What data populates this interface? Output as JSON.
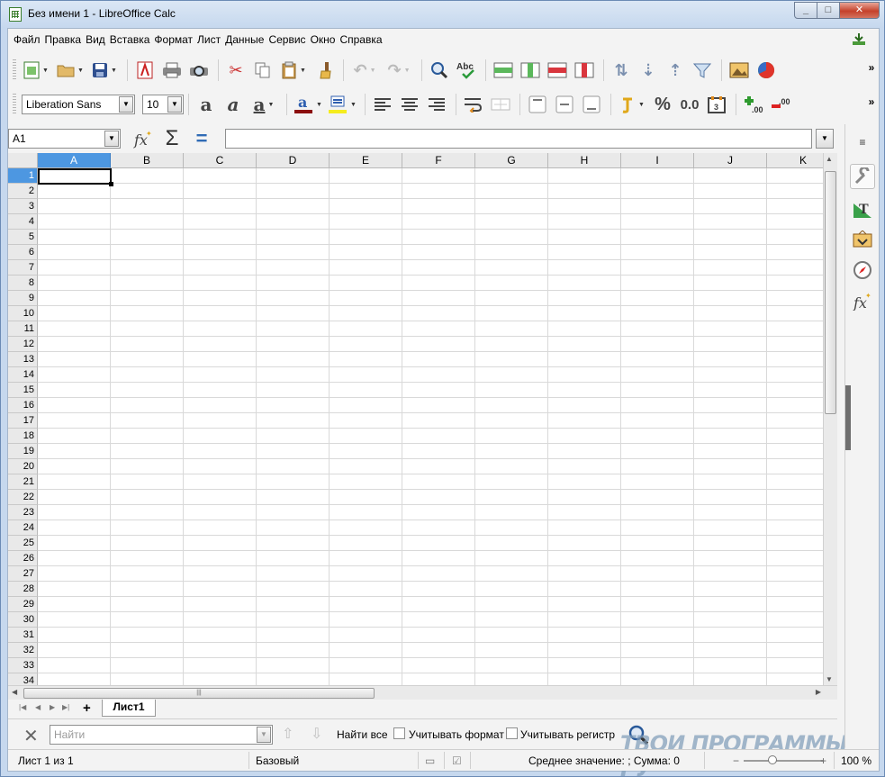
{
  "window": {
    "title": "Без имени 1 - LibreOffice Calc"
  },
  "menu": [
    "Файл",
    "Правка",
    "Вид",
    "Вставка",
    "Формат",
    "Лист",
    "Данные",
    "Сервис",
    "Окно",
    "Справка"
  ],
  "formatting": {
    "font_name": "Liberation Sans",
    "font_size": "10",
    "percent": "%",
    "number_format": "0.0"
  },
  "formula_bar": {
    "name_box": "A1",
    "formula": ""
  },
  "columns": [
    "A",
    "B",
    "C",
    "D",
    "E",
    "F",
    "G",
    "H",
    "I",
    "J",
    "K"
  ],
  "rows": [
    "1",
    "2",
    "3",
    "4",
    "5",
    "6",
    "7",
    "8",
    "9",
    "10",
    "11",
    "12",
    "13",
    "14",
    "15",
    "16",
    "17",
    "18",
    "19",
    "20",
    "21",
    "22",
    "23",
    "24",
    "25",
    "26",
    "27",
    "28",
    "29",
    "30",
    "31",
    "32",
    "33",
    "34"
  ],
  "active_cell": "A1",
  "sheet_tabs": {
    "add": "+",
    "tabs": [
      "Лист1"
    ]
  },
  "find_bar": {
    "placeholder": "Найти",
    "find_all": "Найти все",
    "match_format": "Учитывать формат",
    "match_case": "Учитывать регистр"
  },
  "status": {
    "sheet": "Лист 1 из 1",
    "page_style": "Базовый",
    "summary": "Среднее значение: ; Сумма: 0",
    "zoom": "100 %",
    "zoom_minus": "−",
    "zoom_plus": "+"
  },
  "watermark": "ТВОИ ПРОГРАММЫ РУ",
  "colors": {
    "selection": "#4d97e1",
    "title_bg": "#c6d8ee",
    "close": "#c5412b"
  }
}
